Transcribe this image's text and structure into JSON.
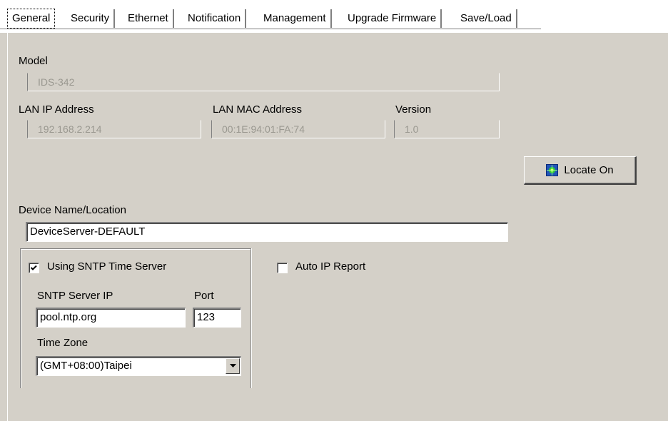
{
  "tabs": [
    {
      "label": "General",
      "active": true
    },
    {
      "label": "Security",
      "active": false
    },
    {
      "label": "Ethernet",
      "active": false
    },
    {
      "label": "Notification",
      "active": false
    },
    {
      "label": "Management",
      "active": false
    },
    {
      "label": "Upgrade Firmware",
      "active": false
    },
    {
      "label": "Save/Load",
      "active": false
    }
  ],
  "general": {
    "model_label": "Model",
    "model_value": "IDS-342",
    "lan_ip_label": "LAN IP Address",
    "lan_ip_value": "192.168.2.214",
    "lan_mac_label": "LAN MAC Address",
    "lan_mac_value": "00:1E:94:01:FA:74",
    "version_label": "Version",
    "version_value": "1.0",
    "locate_button_label": "Locate On",
    "device_name_label": "Device Name/Location",
    "device_name_value": "DeviceServer-DEFAULT",
    "using_sntp_label": "Using SNTP Time Server",
    "using_sntp_checked": true,
    "auto_ip_label": "Auto IP Report",
    "auto_ip_checked": false,
    "sntp_server_label": "SNTP Server IP",
    "sntp_server_value": "pool.ntp.org",
    "port_label": "Port",
    "port_value": "123",
    "timezone_label": "Time Zone",
    "timezone_value": "(GMT+08:00)Taipei"
  },
  "colors": {
    "dialog_bg": "#d4d0c8",
    "disabled_text": "#9a9890",
    "field_bg": "#ffffff"
  },
  "icons": {
    "locate": "network-locate-icon",
    "checkmark": "checkmark-icon",
    "dropdown": "chevron-down-icon"
  }
}
